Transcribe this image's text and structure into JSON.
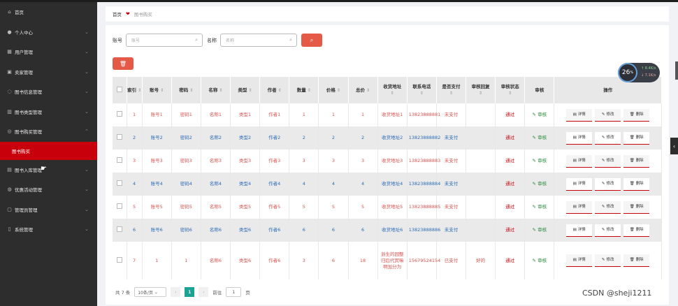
{
  "sidebar": {
    "items": [
      {
        "icon": "home-icon",
        "glyph": "⌂",
        "label": "首页",
        "chevron": false
      },
      {
        "icon": "user-icon",
        "glyph": "●",
        "label": "个人中心",
        "chevron": true
      },
      {
        "icon": "users-icon",
        "glyph": "▦",
        "label": "用户管理",
        "chevron": true
      },
      {
        "icon": "seller-icon",
        "glyph": "▣",
        "label": "卖家管理",
        "chevron": true
      },
      {
        "icon": "book-info-icon",
        "glyph": "◌",
        "label": "图书信息管理",
        "chevron": true
      },
      {
        "icon": "book-type-icon",
        "glyph": "▥",
        "label": "图书类型管理",
        "chevron": true
      },
      {
        "icon": "book-buy-icon",
        "glyph": "◎",
        "label": "图书购买管理",
        "chevron": true,
        "open": true
      }
    ],
    "sub_item": "图书购买",
    "items2": [
      {
        "icon": "book-stock-icon",
        "glyph": "▤",
        "label": "图书入库管理",
        "chevron": true
      },
      {
        "icon": "promo-icon",
        "glyph": "◍",
        "label": "优惠活动管理",
        "chevron": true
      },
      {
        "icon": "admin-icon",
        "glyph": "▢",
        "label": "管理员管理",
        "chevron": true
      },
      {
        "icon": "system-icon",
        "glyph": "▯",
        "label": "系统管理",
        "chevron": true
      }
    ]
  },
  "breadcrumb": {
    "home": "首页",
    "current": "图书购买"
  },
  "search": {
    "account_label": "账号",
    "account_placeholder": "账号",
    "name_label": "名称",
    "name_placeholder": "名称"
  },
  "table": {
    "headers": [
      "索引",
      "账号",
      "密码",
      "名称",
      "类型",
      "作者",
      "数量",
      "价格",
      "总价",
      "收货地址",
      "联系电话",
      "是否支付",
      "审核回复",
      "审核状态",
      "审核",
      "操作"
    ],
    "rows": [
      {
        "idx": "1",
        "account": "账号1",
        "password": "密码1",
        "name": "名称1",
        "type": "类型1",
        "author": "作者1",
        "qty": "1",
        "price": "1",
        "total": "1",
        "address": "收货地址1",
        "phone": "13823888881",
        "paid": "未支付",
        "reply": "",
        "status": "通过",
        "audit": "审核"
      },
      {
        "idx": "2",
        "account": "账号2",
        "password": "密码2",
        "name": "名称2",
        "type": "类型2",
        "author": "作者2",
        "qty": "2",
        "price": "2",
        "total": "2",
        "address": "收货地址2",
        "phone": "13823888882",
        "paid": "未支付",
        "reply": "",
        "status": "通过",
        "audit": "审核"
      },
      {
        "idx": "3",
        "account": "账号3",
        "password": "密码3",
        "name": "名称3",
        "type": "类型3",
        "author": "作者3",
        "qty": "3",
        "price": "3",
        "total": "3",
        "address": "收货地址3",
        "phone": "13823888883",
        "paid": "未支付",
        "reply": "",
        "status": "通过",
        "audit": "审核"
      },
      {
        "idx": "4",
        "account": "账号4",
        "password": "密码4",
        "name": "名称4",
        "type": "类型4",
        "author": "作者4",
        "qty": "4",
        "price": "4",
        "total": "4",
        "address": "收货地址4",
        "phone": "13823888884",
        "paid": "未支付",
        "reply": "",
        "status": "通过",
        "audit": "审核"
      },
      {
        "idx": "5",
        "account": "账号5",
        "password": "密码5",
        "name": "名称5",
        "type": "类型5",
        "author": "作者5",
        "qty": "5",
        "price": "5",
        "total": "5",
        "address": "收货地址5",
        "phone": "13823888885",
        "paid": "未支付",
        "reply": "",
        "status": "通过",
        "audit": "审核"
      },
      {
        "idx": "6",
        "account": "账号6",
        "password": "密码6",
        "name": "名称6",
        "type": "类型6",
        "author": "作者6",
        "qty": "6",
        "price": "6",
        "total": "6",
        "address": "收货地址6",
        "phone": "13823888886",
        "paid": "未支付",
        "reply": "",
        "status": "通过",
        "audit": "审核"
      },
      {
        "idx": "7",
        "account": "1",
        "password": "1",
        "name": "名称6",
        "type": "类型6",
        "author": "作者6",
        "qty": "3",
        "price": "6",
        "total": "18",
        "address": "浙生的园整归后代宾嘛啊加分为",
        "phone": "15679524154",
        "paid": "已支付",
        "reply": "好的",
        "status": "通过",
        "audit": "审核"
      }
    ],
    "actions": {
      "detail": "详情",
      "edit": "修改",
      "delete": "删除"
    }
  },
  "pager": {
    "total": "共 7 条",
    "page_size": "10条/页",
    "current": "1",
    "goto": "前往",
    "goto_value": "1",
    "page_unit": "页"
  },
  "widget": {
    "percent": "26",
    "percent_unit": "%",
    "up": "8.4K/s",
    "down": "7.1K/s"
  },
  "watermark": "CSDN @sheji1211"
}
